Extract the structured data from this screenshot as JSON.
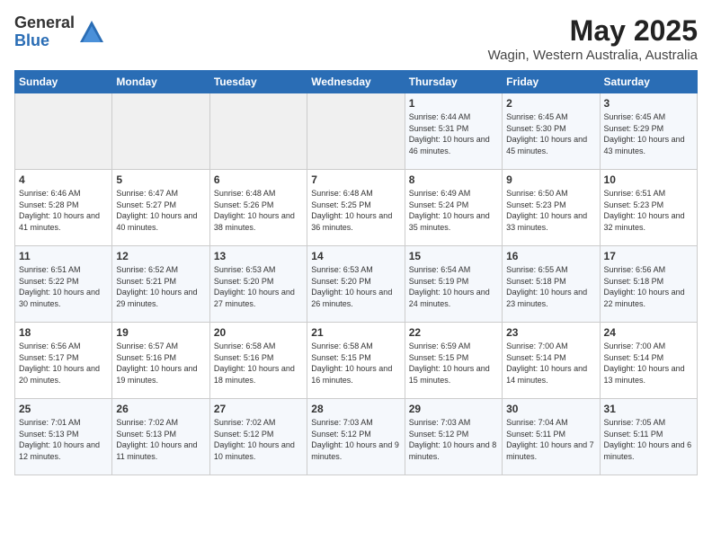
{
  "logo": {
    "general": "General",
    "blue": "Blue"
  },
  "header": {
    "month": "May 2025",
    "location": "Wagin, Western Australia, Australia"
  },
  "weekdays": [
    "Sunday",
    "Monday",
    "Tuesday",
    "Wednesday",
    "Thursday",
    "Friday",
    "Saturday"
  ],
  "weeks": [
    [
      {
        "day": "",
        "empty": true
      },
      {
        "day": "",
        "empty": true
      },
      {
        "day": "",
        "empty": true
      },
      {
        "day": "",
        "empty": true
      },
      {
        "day": "1",
        "sunrise": "6:44 AM",
        "sunset": "5:31 PM",
        "daylight": "10 hours and 46 minutes."
      },
      {
        "day": "2",
        "sunrise": "6:45 AM",
        "sunset": "5:30 PM",
        "daylight": "10 hours and 45 minutes."
      },
      {
        "day": "3",
        "sunrise": "6:45 AM",
        "sunset": "5:29 PM",
        "daylight": "10 hours and 43 minutes."
      }
    ],
    [
      {
        "day": "4",
        "sunrise": "6:46 AM",
        "sunset": "5:28 PM",
        "daylight": "10 hours and 41 minutes."
      },
      {
        "day": "5",
        "sunrise": "6:47 AM",
        "sunset": "5:27 PM",
        "daylight": "10 hours and 40 minutes."
      },
      {
        "day": "6",
        "sunrise": "6:48 AM",
        "sunset": "5:26 PM",
        "daylight": "10 hours and 38 minutes."
      },
      {
        "day": "7",
        "sunrise": "6:48 AM",
        "sunset": "5:25 PM",
        "daylight": "10 hours and 36 minutes."
      },
      {
        "day": "8",
        "sunrise": "6:49 AM",
        "sunset": "5:24 PM",
        "daylight": "10 hours and 35 minutes."
      },
      {
        "day": "9",
        "sunrise": "6:50 AM",
        "sunset": "5:23 PM",
        "daylight": "10 hours and 33 minutes."
      },
      {
        "day": "10",
        "sunrise": "6:51 AM",
        "sunset": "5:23 PM",
        "daylight": "10 hours and 32 minutes."
      }
    ],
    [
      {
        "day": "11",
        "sunrise": "6:51 AM",
        "sunset": "5:22 PM",
        "daylight": "10 hours and 30 minutes."
      },
      {
        "day": "12",
        "sunrise": "6:52 AM",
        "sunset": "5:21 PM",
        "daylight": "10 hours and 29 minutes."
      },
      {
        "day": "13",
        "sunrise": "6:53 AM",
        "sunset": "5:20 PM",
        "daylight": "10 hours and 27 minutes."
      },
      {
        "day": "14",
        "sunrise": "6:53 AM",
        "sunset": "5:20 PM",
        "daylight": "10 hours and 26 minutes."
      },
      {
        "day": "15",
        "sunrise": "6:54 AM",
        "sunset": "5:19 PM",
        "daylight": "10 hours and 24 minutes."
      },
      {
        "day": "16",
        "sunrise": "6:55 AM",
        "sunset": "5:18 PM",
        "daylight": "10 hours and 23 minutes."
      },
      {
        "day": "17",
        "sunrise": "6:56 AM",
        "sunset": "5:18 PM",
        "daylight": "10 hours and 22 minutes."
      }
    ],
    [
      {
        "day": "18",
        "sunrise": "6:56 AM",
        "sunset": "5:17 PM",
        "daylight": "10 hours and 20 minutes."
      },
      {
        "day": "19",
        "sunrise": "6:57 AM",
        "sunset": "5:16 PM",
        "daylight": "10 hours and 19 minutes."
      },
      {
        "day": "20",
        "sunrise": "6:58 AM",
        "sunset": "5:16 PM",
        "daylight": "10 hours and 18 minutes."
      },
      {
        "day": "21",
        "sunrise": "6:58 AM",
        "sunset": "5:15 PM",
        "daylight": "10 hours and 16 minutes."
      },
      {
        "day": "22",
        "sunrise": "6:59 AM",
        "sunset": "5:15 PM",
        "daylight": "10 hours and 15 minutes."
      },
      {
        "day": "23",
        "sunrise": "7:00 AM",
        "sunset": "5:14 PM",
        "daylight": "10 hours and 14 minutes."
      },
      {
        "day": "24",
        "sunrise": "7:00 AM",
        "sunset": "5:14 PM",
        "daylight": "10 hours and 13 minutes."
      }
    ],
    [
      {
        "day": "25",
        "sunrise": "7:01 AM",
        "sunset": "5:13 PM",
        "daylight": "10 hours and 12 minutes."
      },
      {
        "day": "26",
        "sunrise": "7:02 AM",
        "sunset": "5:13 PM",
        "daylight": "10 hours and 11 minutes."
      },
      {
        "day": "27",
        "sunrise": "7:02 AM",
        "sunset": "5:12 PM",
        "daylight": "10 hours and 10 minutes."
      },
      {
        "day": "28",
        "sunrise": "7:03 AM",
        "sunset": "5:12 PM",
        "daylight": "10 hours and 9 minutes."
      },
      {
        "day": "29",
        "sunrise": "7:03 AM",
        "sunset": "5:12 PM",
        "daylight": "10 hours and 8 minutes."
      },
      {
        "day": "30",
        "sunrise": "7:04 AM",
        "sunset": "5:11 PM",
        "daylight": "10 hours and 7 minutes."
      },
      {
        "day": "31",
        "sunrise": "7:05 AM",
        "sunset": "5:11 PM",
        "daylight": "10 hours and 6 minutes."
      }
    ]
  ]
}
